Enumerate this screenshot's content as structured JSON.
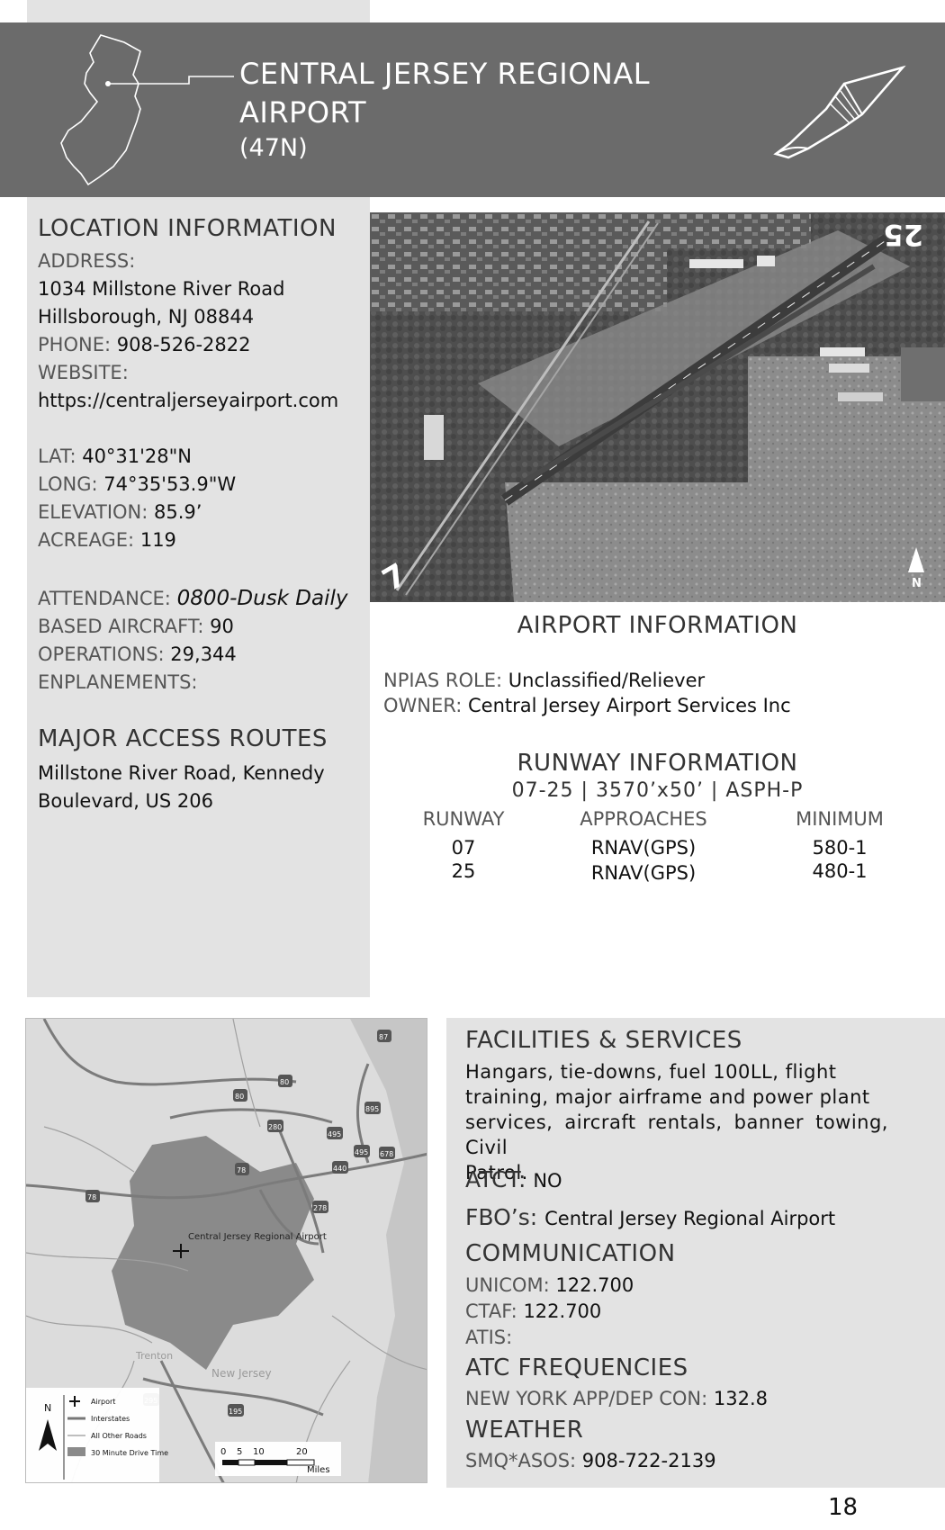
{
  "header": {
    "title_line1": "CENTRAL JERSEY REGIONAL",
    "title_line2": "AIRPORT",
    "code": "(47N)"
  },
  "location": {
    "title": "LOCATION  INFORMATION",
    "address_label": "ADDRESS:",
    "address_line1": "1034 Millstone River Road",
    "address_line2": "Hillsborough, NJ 08844",
    "phone_label": "PHONE:",
    "phone": "908-526-2822",
    "website_label": "WEBSITE:",
    "website": "https://centraljerseyairport.com",
    "lat_label": "LAT:",
    "lat": "40°31'28\"N",
    "long_label": "LONG:",
    "long": "74°35'53.9\"W",
    "elevation_label": "ELEVATION:",
    "elevation": "85.9’",
    "acreage_label": "ACREAGE:",
    "acreage": "119",
    "attendance_label": "ATTENDANCE:",
    "attendance": "0800-Dusk Daily",
    "based_label": "BASED AIRCRAFT:",
    "based": "90",
    "operations_label": "OPERATIONS:",
    "operations": "29,344",
    "enplanements_label": "ENPLANEMENTS:",
    "enplanements": ""
  },
  "access": {
    "title": "MAJOR ACCESS ROUTES",
    "line1": "Millstone River Road, Kennedy",
    "line2": "Boulevard, US 206"
  },
  "aerial": {
    "runway_end_a": "25",
    "runway_end_b": "7",
    "north_label": "N"
  },
  "airport_info": {
    "title": "AIRPORT  INFORMATION",
    "npias_label": "NPIAS  ROLE:",
    "npias": "Unclassified/Reliever",
    "owner_label": "OWNER:",
    "owner": "Central Jersey Airport Services Inc"
  },
  "runway": {
    "title": "RUNWAY INFORMATION",
    "summary": "07-25 | 3570’x50’ | ASPH-P",
    "headers": [
      "RUNWAY",
      "APPROACHES",
      "MINIMUM"
    ],
    "rows": [
      {
        "runway": "07",
        "approach": "RNAV(GPS)",
        "minimum": "580-1"
      },
      {
        "runway": "25",
        "approach": "RNAV(GPS)",
        "minimum": "480-1"
      }
    ]
  },
  "map": {
    "airport_label": "Central Jersey Regional Airport",
    "trenton": "Trenton",
    "new_jersey": "New Jersey",
    "shields": [
      "87",
      "80",
      "80",
      "895",
      "280",
      "495",
      "495",
      "678",
      "78",
      "78",
      "440",
      "278",
      "295",
      "195"
    ],
    "legend": [
      "Airport",
      "Interstates",
      "All Other Roads",
      "30 Minute Drive Time"
    ],
    "north": "N",
    "scale_ticks": [
      "0",
      "5",
      "10",
      "20"
    ],
    "scale_unit": "Miles"
  },
  "facilities": {
    "title": "FACILITIES & SERVICES",
    "line1": "Hangars,  tie-downs,  fuel  100LL,  flight",
    "line2": "training,  major  airframe  and  power  plant",
    "line3": "services, aircraft rentals, banner towing, Civil",
    "line4": "Patrol.",
    "atct_label": "ATCT:",
    "atct": "NO",
    "fbo_label": "FBO’s:",
    "fbo": "Central Jersey Regional Airport",
    "comm_title": "COMMUNICATION",
    "unicom_label": "UNICOM:",
    "unicom": "122.700",
    "ctaf_label": "CTAF:",
    "ctaf": "122.700",
    "atis_label": "ATIS:",
    "atis": "",
    "atc_title": "ATC FREQUENCIES",
    "ny_label": "NEW YORK APP/DEP CON:",
    "ny": "132.8",
    "weather_title": "WEATHER",
    "asos_label": "SMQ*ASOS:",
    "asos": "908-722-2139"
  },
  "page_number": "18",
  "colors": {
    "header_bg": "#6b6b6b",
    "panel_bg": "#e3e3e3",
    "drive_time_area": "#8a8a8a"
  }
}
